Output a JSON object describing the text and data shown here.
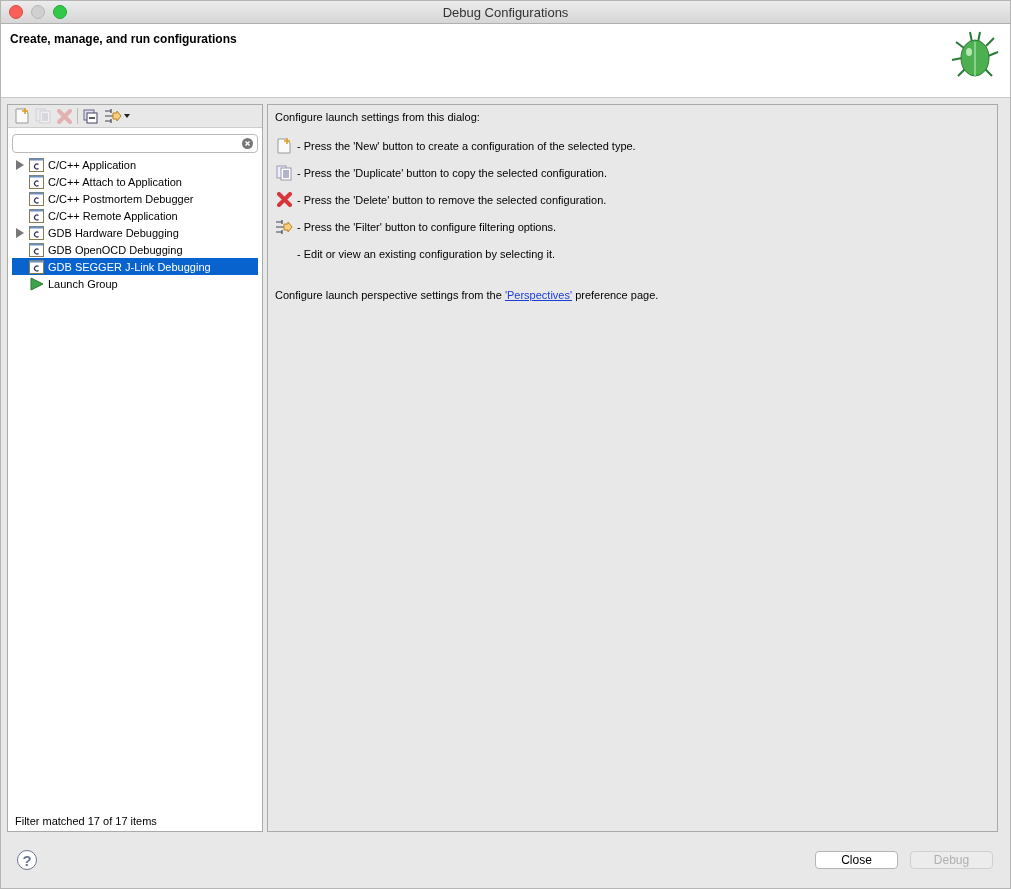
{
  "window": {
    "title": "Debug Configurations"
  },
  "header": {
    "title": "Create, manage, and run configurations"
  },
  "toolbar": [
    {
      "kind": "new",
      "disabled": false
    },
    {
      "kind": "duplicate",
      "disabled": true
    },
    {
      "kind": "delete",
      "disabled": true
    },
    {
      "kind": "collapse",
      "disabled": false
    },
    {
      "kind": "filter",
      "disabled": false
    }
  ],
  "tree": [
    {
      "label": "C/C++ Application",
      "kind": "config",
      "expandable": true,
      "selected": false
    },
    {
      "label": "C/C++ Attach to Application",
      "kind": "config",
      "expandable": false,
      "selected": false
    },
    {
      "label": "C/C++ Postmortem Debugger",
      "kind": "config",
      "expandable": false,
      "selected": false
    },
    {
      "label": "C/C++ Remote Application",
      "kind": "config",
      "expandable": false,
      "selected": false
    },
    {
      "label": "GDB Hardware Debugging",
      "kind": "config",
      "expandable": true,
      "selected": false
    },
    {
      "label": "GDB OpenOCD Debugging",
      "kind": "config",
      "expandable": false,
      "selected": false
    },
    {
      "label": "GDB SEGGER J-Link Debugging",
      "kind": "config",
      "expandable": false,
      "selected": true
    },
    {
      "label": "Launch Group",
      "kind": "group",
      "expandable": false,
      "selected": false
    }
  ],
  "filter_status": "Filter matched 17 of 17 items",
  "intro": "Configure launch settings from this dialog:",
  "instructions": [
    {
      "kind": "new",
      "text": "- Press the 'New' button to create a configuration of the selected type."
    },
    {
      "kind": "duplicate",
      "text": "- Press the 'Duplicate' button to copy the selected configuration."
    },
    {
      "kind": "delete",
      "text": "- Press the 'Delete' button to remove the selected configuration."
    },
    {
      "kind": "filter",
      "text": "- Press the 'Filter' button to configure filtering options."
    },
    {
      "kind": "none",
      "text": "- Edit or view an existing configuration by selecting it."
    }
  ],
  "perspectives": {
    "before": "Configure launch perspective settings from the",
    "link": "'Perspectives'",
    "after": "preference page."
  },
  "help": "?",
  "buttons": [
    {
      "label": "Close",
      "disabled": false
    },
    {
      "label": "Debug",
      "disabled": true
    }
  ]
}
